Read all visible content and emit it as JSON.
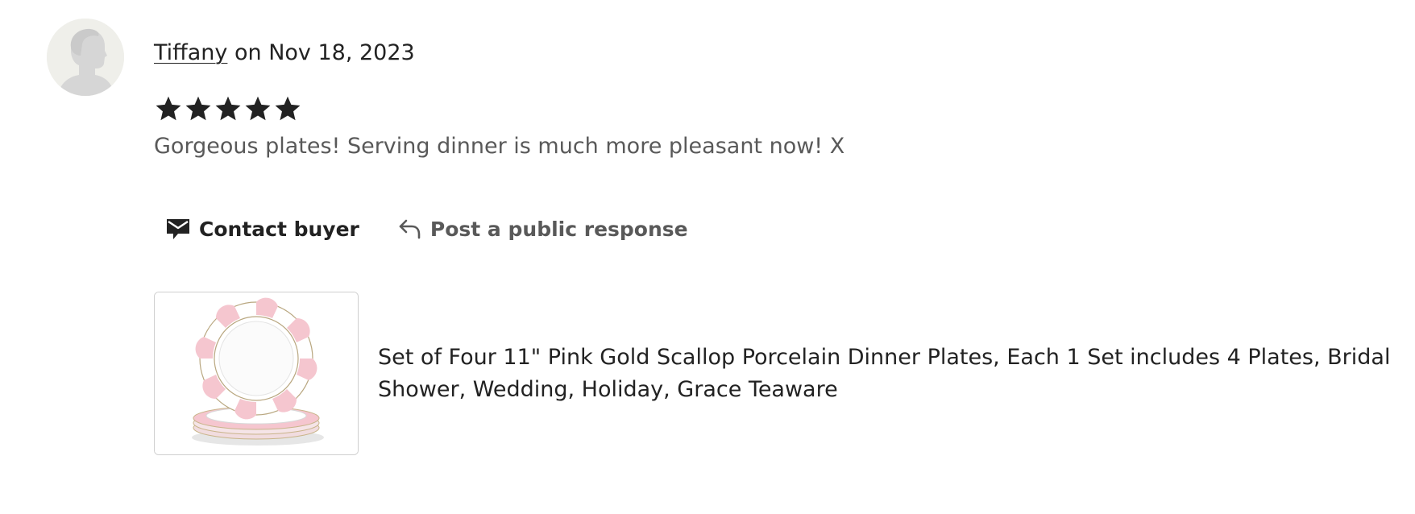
{
  "review": {
    "reviewer_name": "Tiffany",
    "date_text": " on Nov 18, 2023",
    "rating": 5,
    "rating_max": 5,
    "text": "Gorgeous plates! Serving dinner is much more pleasant now! X"
  },
  "actions": {
    "contact_label": "Contact buyer",
    "contact_icon": "envelope-icon",
    "respond_label": "Post a public response",
    "respond_icon": "reply-arrow-icon"
  },
  "listing": {
    "title": "Set of Four 11\" Pink Gold Scallop Porcelain Dinner Plates, Each 1 Set includes 4 Plates, Bridal Shower, Wedding, Holiday, Grace Teaware",
    "image_subject": "stacked-pink-scallop-plates"
  },
  "colors": {
    "text_primary": "#222222",
    "text_secondary": "#595959",
    "avatar_bg": "#efefea",
    "avatar_silhouette": "#d6d6d6",
    "plate_pink": "#f5c6cf"
  }
}
